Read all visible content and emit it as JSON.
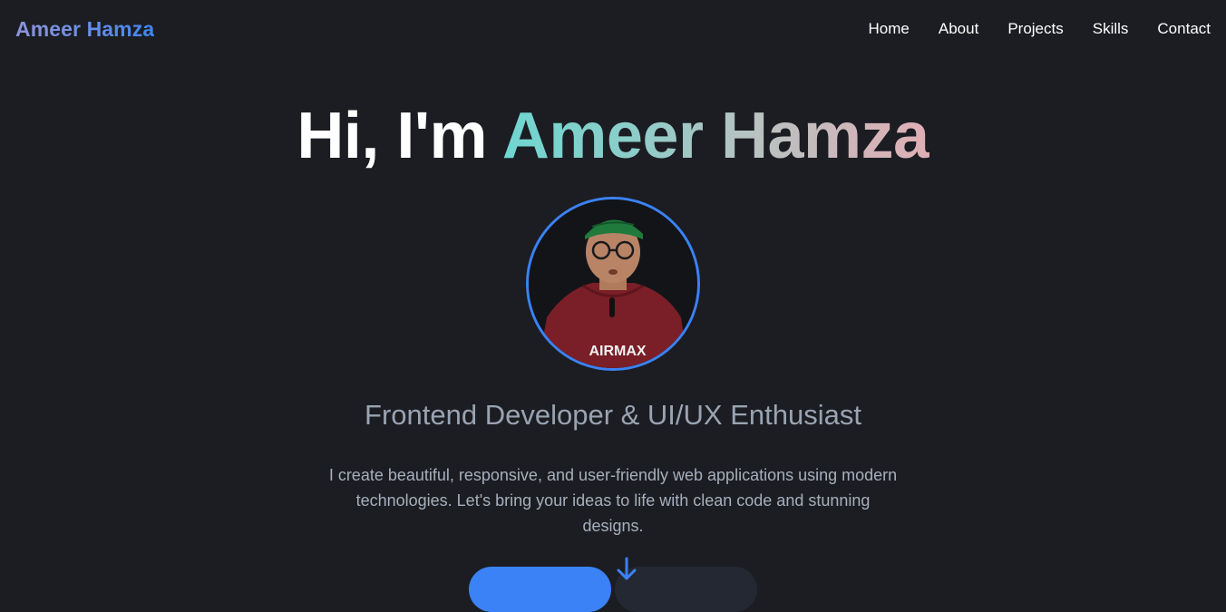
{
  "brand": {
    "name": "Ameer Hamza"
  },
  "nav": {
    "items": [
      {
        "label": "Home"
      },
      {
        "label": "About"
      },
      {
        "label": "Projects"
      },
      {
        "label": "Skills"
      },
      {
        "label": "Contact"
      }
    ]
  },
  "hero": {
    "greeting": "Hi, I'm ",
    "name": "Ameer Hamza",
    "subtitle": "Frontend Developer & UI/UX Enthusiast",
    "description": "I create beautiful, responsive, and user-friendly web applications using modern technologies. Let's bring your ideas to life with clean code and stunning designs.",
    "avatar_shirt_text": "AIRMAX"
  },
  "colors": {
    "background": "#1b1d22",
    "accent": "#3b82f6",
    "text_muted": "#9aa3b2"
  },
  "icons": {
    "scroll": "arrow-down-icon"
  }
}
